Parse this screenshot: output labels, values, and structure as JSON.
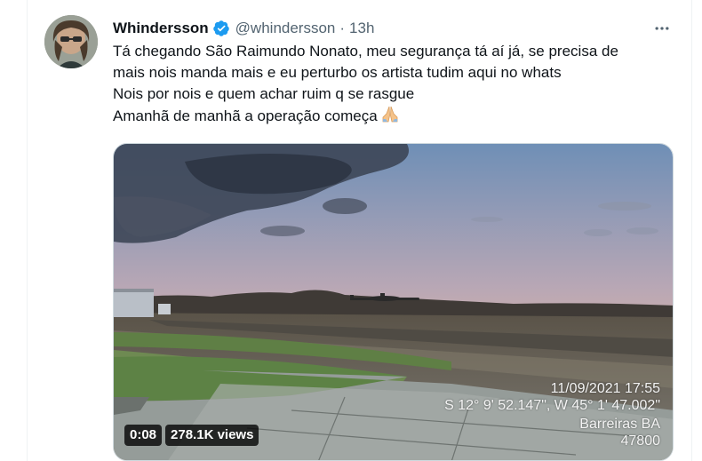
{
  "tweet": {
    "display_name": "Whindersson",
    "verified_icon": "verified-badge-icon",
    "handle": "@whindersson",
    "separator": "·",
    "time": "13h",
    "more_icon": "more-options-icon",
    "text_lines": [
      "Tá chegando São Raimundo Nonato, meu segurança tá aí já, se precisa de",
      "mais nois manda mais e eu perturbo os artista tudim aqui no whats",
      "Nois por nois e quem achar ruim q se rasgue",
      "Amanhã de manhã a operação começa"
    ],
    "emoji": "folded-hands-icon"
  },
  "video": {
    "overlay_date": "11/09/2021 17:55",
    "overlay_coords": "S 12° 9' 52.147\", W 45° 1' 47.002\"",
    "overlay_place": "Barreiras BA",
    "overlay_code": "47800",
    "duration": "0:08",
    "views": "278.1K views"
  },
  "colors": {
    "accent_blue": "#1d9bf0",
    "text_primary": "#0f1419",
    "text_secondary": "#536471",
    "border": "#cfd9de"
  }
}
